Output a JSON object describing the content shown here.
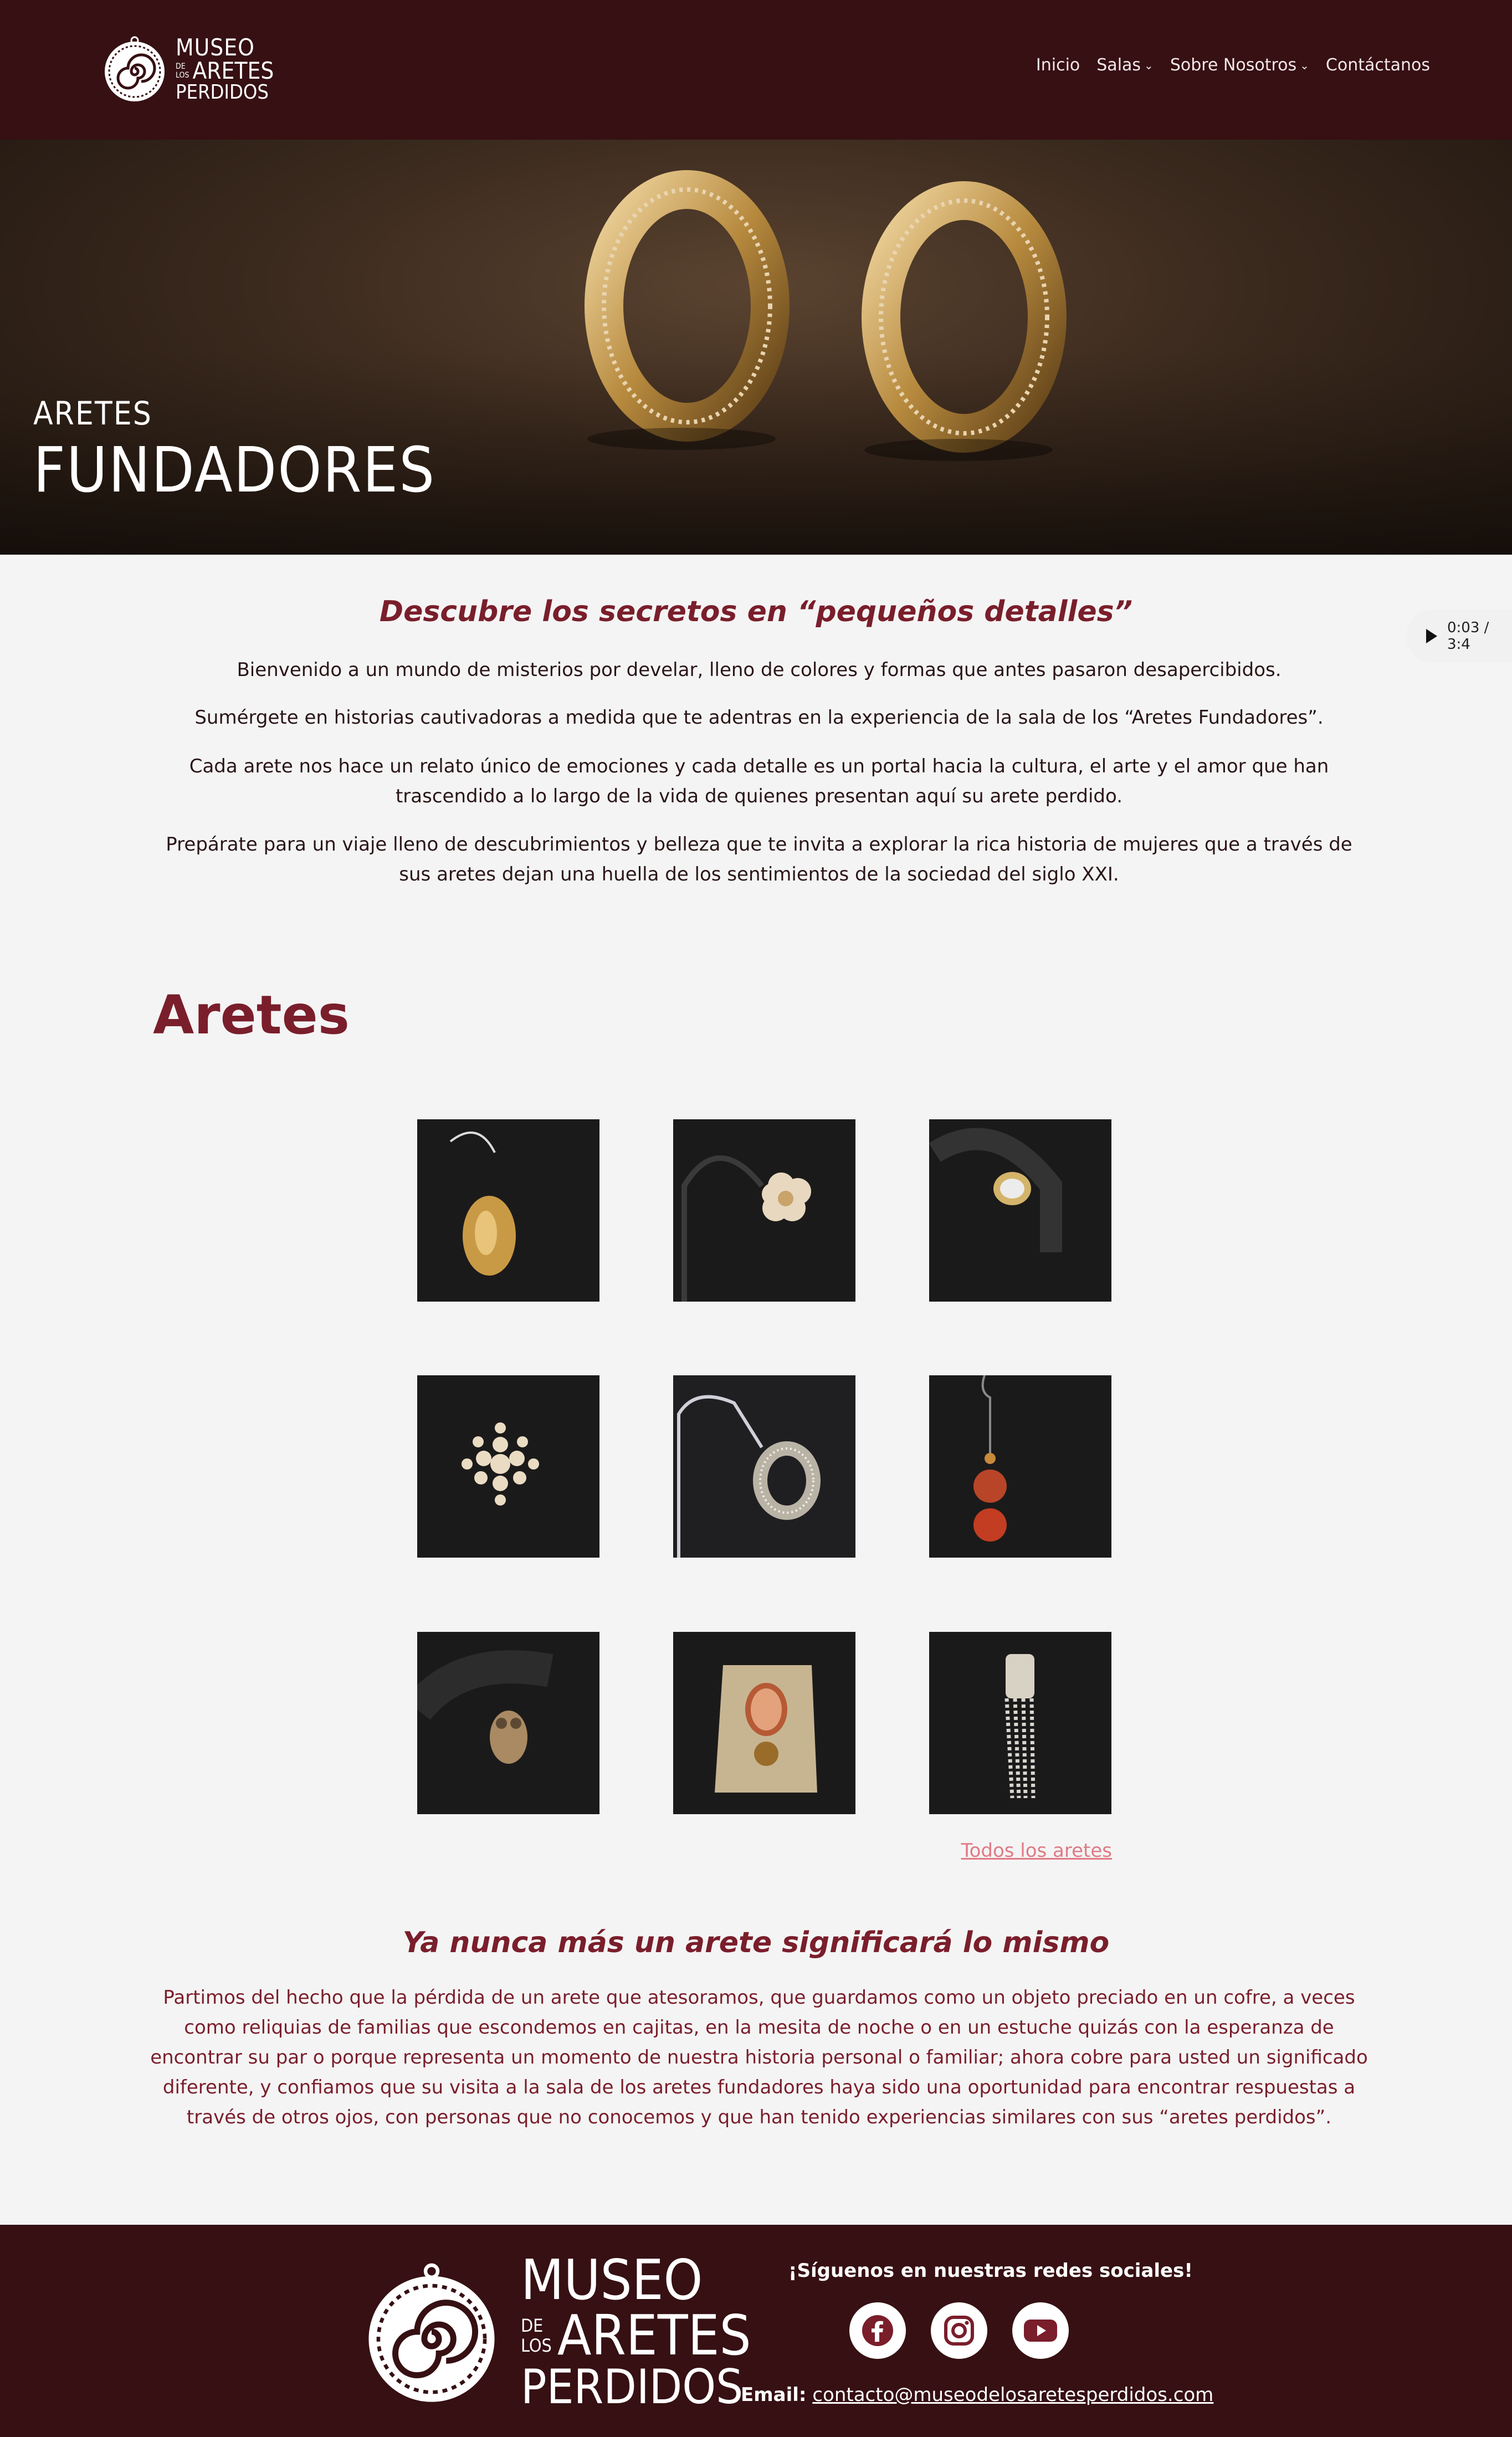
{
  "brand": {
    "line1": "MUSEO",
    "small_de": "DE",
    "small_los": "LOS",
    "line2": "ARETES",
    "line3": "PERDIDOS",
    "primary_color": "#361013",
    "accent_color": "#7a1e2b"
  },
  "nav": {
    "inicio": "Inicio",
    "salas": "Salas",
    "sobre": "Sobre Nosotros",
    "contacto": "Contáctanos"
  },
  "hero": {
    "subtitle": "ARETES",
    "title": "FUNDADORES"
  },
  "audio": {
    "time": "0:03 / 3:4"
  },
  "intro": {
    "heading": "Descubre los secretos en “pequeños detalles”",
    "p1": "Bienvenido a un mundo de misterios por develar, lleno de colores y formas que antes pasaron desapercibidos.",
    "p2": "Sumérgete en historias cautivadoras a medida que te adentras en la experiencia de la sala de los “Aretes Fundadores”.",
    "p3": "Cada arete nos hace un relato único de emociones  y cada detalle es un portal hacia la cultura, el arte y el amor  que han trascendido a lo largo de la vida de quienes presentan aquí su arete perdido.",
    "p4": "Prepárate para un viaje lleno de descubrimientos y belleza que te invita a explorar la rica historia de mujeres que a través de sus aretes dejan una huella de los sentimientos de la sociedad del siglo XXI."
  },
  "aretes": {
    "title": "Aretes",
    "items": [
      {
        "icon": "gold-oval-hoop-earring"
      },
      {
        "icon": "pearl-flower-earring"
      },
      {
        "icon": "crystal-stud-earring"
      },
      {
        "icon": "pearl-cluster-earring"
      },
      {
        "icon": "rhinestone-huggie-earring"
      },
      {
        "icon": "red-bead-drop-earring"
      },
      {
        "icon": "owl-earring"
      },
      {
        "icon": "cameo-earring"
      },
      {
        "icon": "crystal-fringe-earring"
      }
    ],
    "all_link": "Todos los aretes"
  },
  "closing": {
    "heading": "Ya nunca más un arete significará lo mismo",
    "text": "Partimos del hecho que la pérdida de un arete que atesoramos, que guardamos como un objeto preciado en un cofre, a veces como reliquias de familias que escondemos en cajitas, en la mesita de noche o en un estuche quizás con la esperanza de encontrar su par o porque representa un momento de nuestra historia personal o familiar; ahora cobre para usted un significado diferente, y confiamos que su visita a la sala de los aretes fundadores haya sido una oportunidad para encontrar respuestas a través de otros ojos, con personas que no conocemos y que han tenido experiencias similares con sus “aretes perdidos”."
  },
  "footer": {
    "follow": "¡Síguenos en nuestras redes sociales!",
    "email_label": "Email:",
    "email": "contacto@museodelosaretesperdidos.com",
    "socials": [
      "facebook-icon",
      "instagram-icon",
      "youtube-icon"
    ]
  }
}
